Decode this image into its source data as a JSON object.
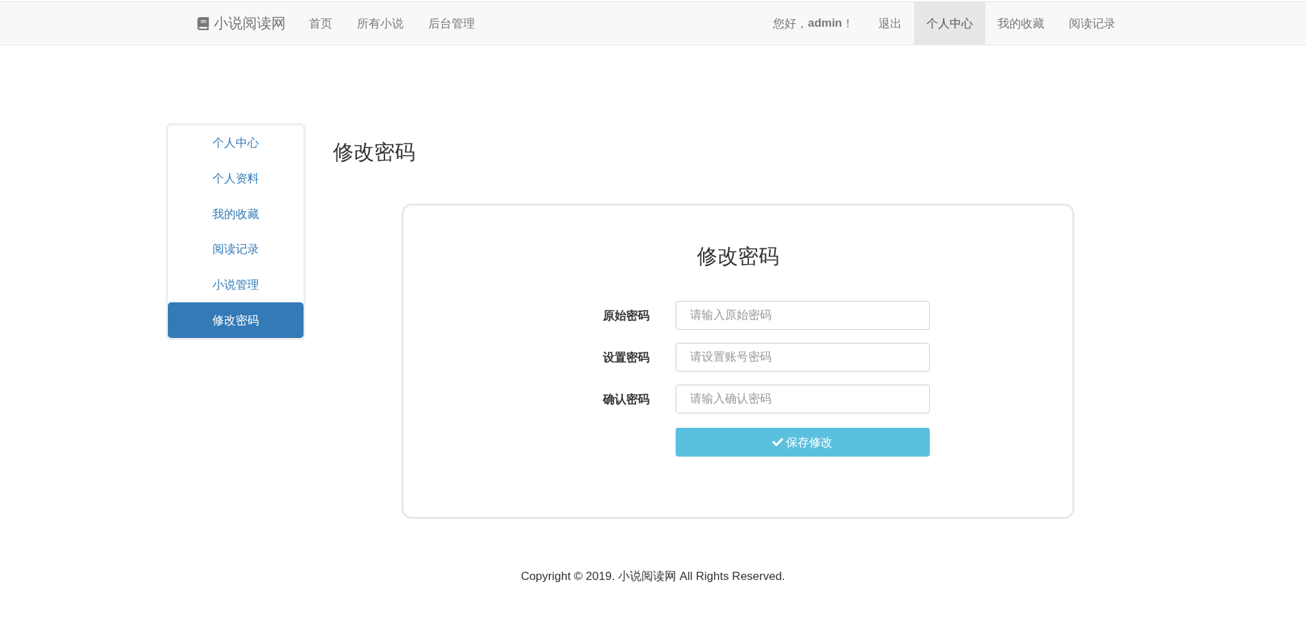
{
  "navbar": {
    "brand": "小说阅读网",
    "left_links": [
      {
        "label": "首页",
        "selected": false
      },
      {
        "label": "所有小说",
        "selected": false
      },
      {
        "label": "后台管理",
        "selected": false
      }
    ],
    "greeting": "您好，**admin**！",
    "right_links": [
      {
        "label": "退出",
        "selected": false
      },
      {
        "label": "个人中心",
        "selected": true
      },
      {
        "label": "我的收藏",
        "selected": false
      },
      {
        "label": "阅读记录",
        "selected": false
      }
    ]
  },
  "sidebar": {
    "items": [
      {
        "label": "个人中心",
        "selected": false
      },
      {
        "label": "个人资料",
        "selected": false
      },
      {
        "label": "我的收藏",
        "selected": false
      },
      {
        "label": "阅读记录",
        "selected": false
      },
      {
        "label": "小说管理",
        "selected": false
      },
      {
        "label": "修改密码",
        "selected": true
      }
    ]
  },
  "page_title": "修改密码",
  "form": {
    "title": "修改密码",
    "fields": [
      {
        "label": "原始密码",
        "placeholder": "请输入原始密码"
      },
      {
        "label": "设置密码",
        "placeholder": "请设置账号密码"
      },
      {
        "label": "确认密码",
        "placeholder": "请输入确认密码"
      }
    ],
    "submit_button": "保存修改"
  },
  "footer": "Copyright © 2019. 小说阅读网 All Rights Reserved."
}
